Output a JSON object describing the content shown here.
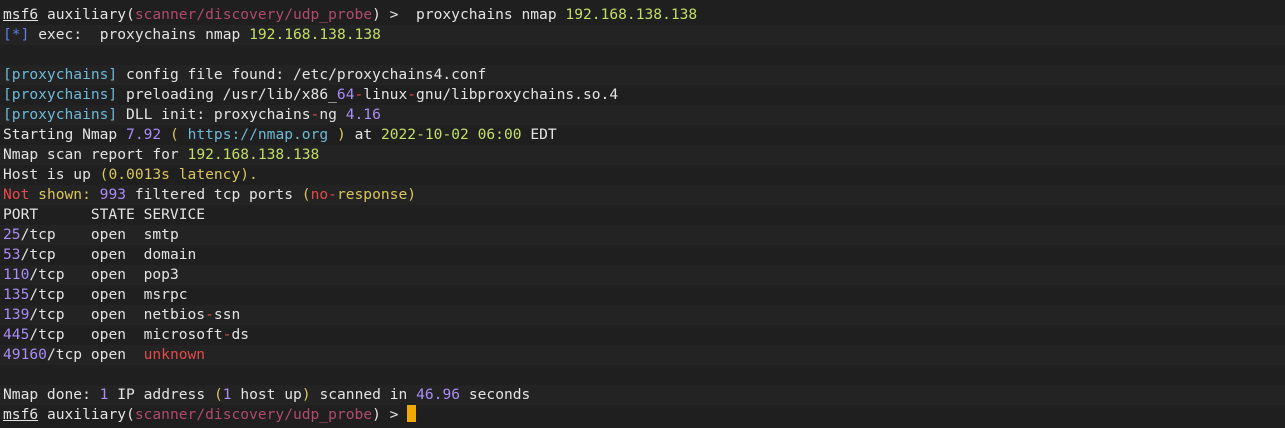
{
  "prompt": {
    "user": "msf6",
    "module_type": "auxiliary",
    "module_path": "scanner/discovery/udp_probe",
    "symbol": ">"
  },
  "command": "proxychains nmap",
  "target_ip": "192.168.138.138",
  "exec_line": {
    "marker_open": "[",
    "marker": "*",
    "marker_close": "]",
    "label": "exec:",
    "command": "proxychains nmap"
  },
  "proxychains": {
    "tag": "[proxychains]",
    "config_text": "config file found:",
    "config_path": "/etc/proxychains4.conf",
    "preload_text": "preloading /usr/lib/x86",
    "preload_sep1": "_",
    "preload_mid": "64",
    "preload_sep2": "-",
    "preload_mid2": "linux",
    "preload_sep3": "-",
    "preload_end": "gnu/libproxychains.so.4",
    "dll_text": "DLL init: proxychains",
    "dll_sep": "-",
    "dll_name": "ng",
    "dll_version": "4.16"
  },
  "nmap": {
    "start_a": "Starting Nmap",
    "version": "7.92",
    "paren_open": "(",
    "url": "https://nmap.org",
    "paren_close": ")",
    "at": "at",
    "date": "2022-10-02",
    "time": "06:00",
    "tz": "EDT",
    "report_text": "Nmap scan report for",
    "host_up_a": "Host is up",
    "latency": "(0.0013s latency).",
    "not_shown_a": "Not",
    "not_shown_b": "shown:",
    "filtered_count": "993",
    "filtered_text": "filtered tcp ports",
    "no_response_open": "(",
    "no_resp_a": "no",
    "no_resp_sep": "-",
    "no_resp_b": "response",
    "no_response_close": ")",
    "header": "PORT      STATE SERVICE",
    "ports": [
      {
        "num": "25",
        "proto": "/tcp    ",
        "state": "open  ",
        "service": "smtp"
      },
      {
        "num": "53",
        "proto": "/tcp    ",
        "state": "open  ",
        "service": "domain"
      },
      {
        "num": "110",
        "proto": "/tcp   ",
        "state": "open  ",
        "service": "pop3"
      },
      {
        "num": "135",
        "proto": "/tcp   ",
        "state": "open  ",
        "service": "msrpc"
      },
      {
        "num": "139",
        "proto": "/tcp   ",
        "state": "open  ",
        "service_a": "netbios",
        "service_sep": "-",
        "service_b": "ssn"
      },
      {
        "num": "445",
        "proto": "/tcp   ",
        "state": "open  ",
        "service_a": "microsoft",
        "service_sep": "-",
        "service_b": "ds"
      },
      {
        "num": "49160",
        "proto": "/tcp ",
        "state": "open  ",
        "service": "unknown"
      }
    ],
    "done_a": "Nmap done:",
    "done_count": "1",
    "done_b": "IP address",
    "done_paren_open": "(",
    "done_hosts": "1",
    "done_c": "host up",
    "done_paren_close": ")",
    "done_d": "scanned in",
    "done_time": "46.96",
    "done_e": "seconds"
  }
}
